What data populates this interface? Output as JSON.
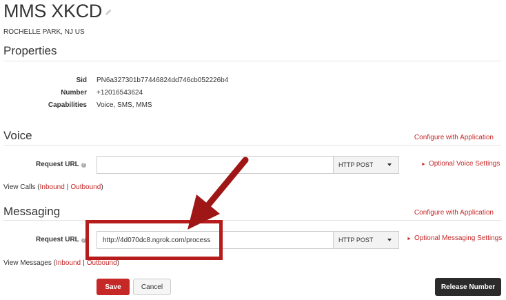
{
  "header": {
    "title": "MMS XKCD",
    "location": "ROCHELLE PARK, NJ US"
  },
  "properties": {
    "heading": "Properties",
    "rows": [
      {
        "label": "Sid",
        "value": "PN6a327301b77446824dd746cb052226b4"
      },
      {
        "label": "Number",
        "value": "+12016543624"
      },
      {
        "label": "Capabilities",
        "value": "Voice, SMS, MMS"
      }
    ]
  },
  "voice": {
    "heading": "Voice",
    "configure_link": "Configure with Application",
    "request_url_label": "Request URL",
    "request_url_value": "",
    "method": "HTTP POST",
    "optional_settings": "Optional Voice Settings",
    "view_prefix": "View Calls (",
    "inbound": "Inbound",
    "separator": "|",
    "outbound": "Outbound",
    "close": ")"
  },
  "messaging": {
    "heading": "Messaging",
    "configure_link": "Configure with Application",
    "request_url_label": "Request URL",
    "request_url_value": "http://4d070dc8.ngrok.com/process",
    "method": "HTTP POST",
    "optional_settings": "Optional Messaging Settings",
    "view_prefix": "View Messages (",
    "inbound": "Inbound",
    "separator": "|",
    "outbound": "Outbound",
    "close": ")"
  },
  "actions": {
    "save": "Save",
    "cancel": "Cancel",
    "release": "Release Number"
  },
  "colors": {
    "accent": "#c62828",
    "annotation": "#b71c1c",
    "dark_button": "#2b2b2b"
  }
}
